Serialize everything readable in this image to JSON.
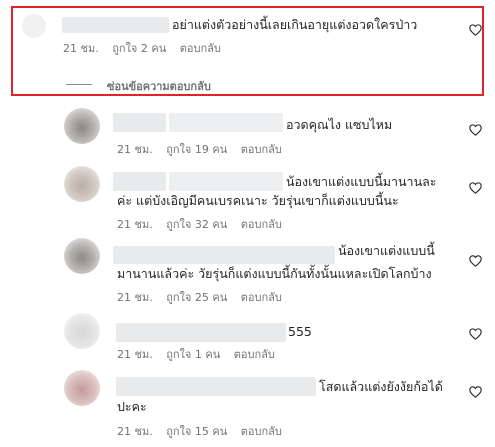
{
  "comments": [
    {
      "text": "อย่าแต่งตัวอย่างนี้เลยเกินอายุแต่งอวดใครป่าว",
      "time": "21 ชม.",
      "likes": "ถูกใจ 2 คน",
      "reply": "ตอบกลับ",
      "hide_replies": "ซ่อนข้อความตอบกลับ"
    }
  ],
  "replies": [
    {
      "text": "อวดคุณไง แซบไหม",
      "time": "21 ชม.",
      "likes": "ถูกใจ 19 คน",
      "reply": "ตอบกลับ"
    },
    {
      "text_line1": "น้องเขาแต่งแบบนี้มานานละ",
      "text_line2": "ค่ะ แต่บังเอิญมีคนเบรคเนาะ วัยรุ่นเขาก็แต่งแบบนี้นะ",
      "time": "21 ชม.",
      "likes": "ถูกใจ 32 คน",
      "reply": "ตอบกลับ"
    },
    {
      "text_line1": "น้องเขาแต่งแบบนี้",
      "text_line2": "มานานแล้วค่ะ วัยรุ่นก็แต่งแบบนี้กันทั้งนั้นแหละเปิดโลกบ้าง",
      "time": "21 ชม.",
      "likes": "ถูกใจ 25 คน",
      "reply": "ตอบกลับ"
    },
    {
      "text": "555",
      "time": "21 ชม.",
      "likes": "ถูกใจ 1 คน",
      "reply": "ตอบกลับ"
    },
    {
      "text_line1": "โสดแล้วแต่งยังงัยก้อได้",
      "text_line2": "ปะคะ",
      "time": "21 ชม.",
      "likes": "ถูกใจ 15 คน",
      "reply": "ตอบกลับ"
    }
  ],
  "colors": {
    "highlight_border": "#e0242b",
    "meta_text": "#737373",
    "blur_placeholder": "#e9eaec"
  },
  "icons": {
    "like": "heart-outline-icon"
  }
}
